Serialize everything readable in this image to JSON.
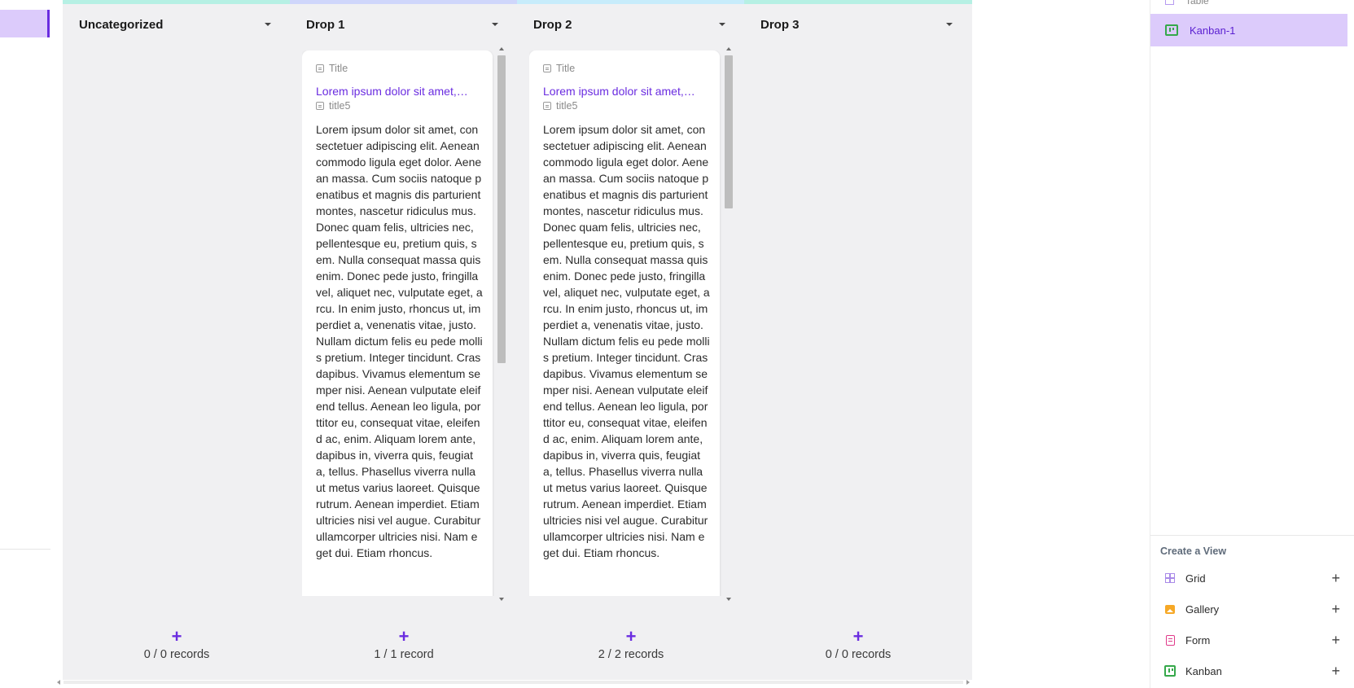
{
  "columns": [
    {
      "title": "Uncategorized",
      "topbar_color": "#b6f0e4",
      "count": "0 / 0 records",
      "has_card": false
    },
    {
      "title": "Drop 1",
      "topbar_color": "#cfd6fb",
      "count": "1 / 1 record",
      "has_card": true
    },
    {
      "title": "Drop 2",
      "topbar_color": "#c7ecfb",
      "count": "2 / 2 records",
      "has_card": true
    },
    {
      "title": "Drop 3",
      "topbar_color": "#b6f0e4",
      "count": "0 / 0 records",
      "has_card": false
    }
  ],
  "card": {
    "title_label": "Title",
    "title_value": "Lorem ipsum dolor sit amet,…",
    "body_label": "title5",
    "body_value": "Lorem ipsum dolor sit amet, consectetuer adipiscing elit. Aenean commodo ligula eget dolor. Aenean massa. Cum sociis natoque penatibus et magnis dis parturient montes, nascetur ridiculus mus. Donec quam felis, ultricies nec, pellentesque eu, pretium quis, sem. Nulla consequat massa quis enim. Donec pede justo, fringilla vel, aliquet nec, vulputate eget, arcu. In enim justo, rhoncus ut, imperdiet a, venenatis vitae, justo. Nullam dictum felis eu pede mollis pretium. Integer tincidunt. Cras dapibus. Vivamus elementum semper nisi. Aenean vulputate eleifend tellus. Aenean leo ligula, porttitor eu, consequat vitae, eleifend ac, enim. Aliquam lorem ante, dapibus in, viverra quis, feugiat a, tellus. Phasellus viverra nulla ut metus varius laoreet. Quisque rutrum. Aenean imperdiet. Etiam ultricies nisi vel augue. Curabitur ullamcorper ultricies nisi. Nam eget dui. Etiam rhoncus."
  },
  "add_symbol": "+",
  "sidebar": {
    "partial_view": "Table",
    "active_view": "Kanban-1",
    "create_title": "Create a View",
    "create_items": [
      {
        "label": "Grid",
        "icon": "grid-icon"
      },
      {
        "label": "Gallery",
        "icon": "gallery-icon"
      },
      {
        "label": "Form",
        "icon": "form-icon"
      },
      {
        "label": "Kanban",
        "icon": "kanban-icon"
      }
    ],
    "add_symbol": "+"
  },
  "colors": {
    "accent": "#6a2ce0",
    "active_bg": "#dccbfb"
  }
}
